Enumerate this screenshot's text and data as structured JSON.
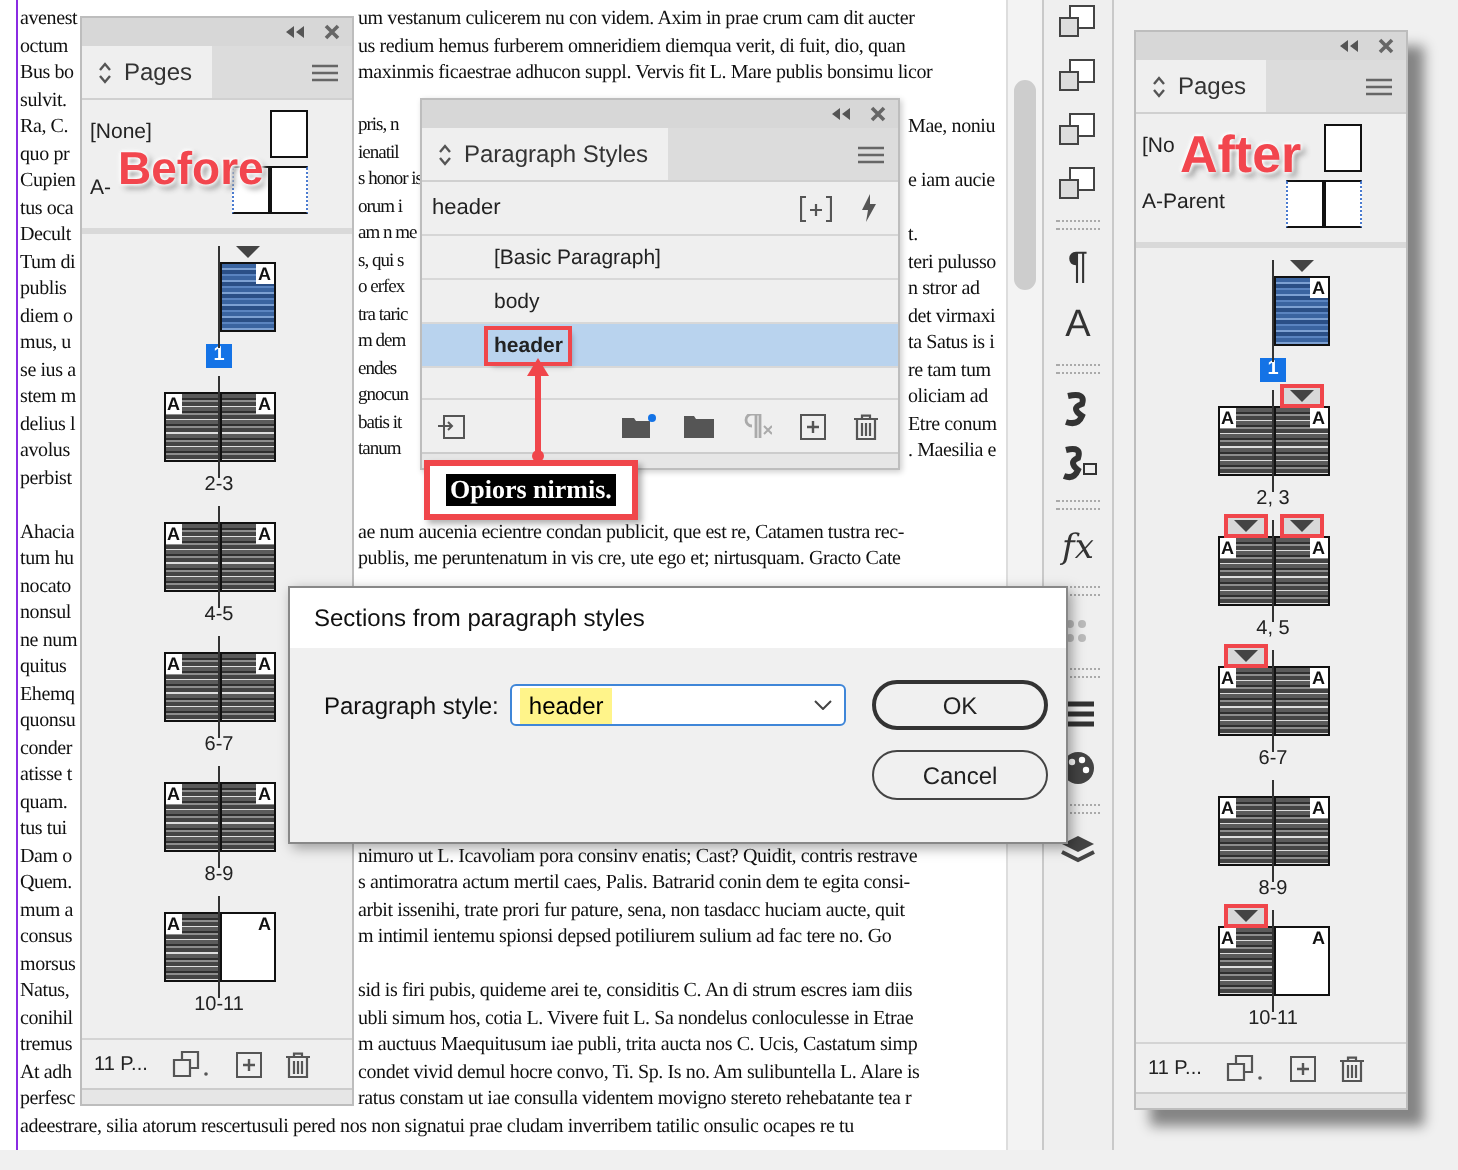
{
  "document": {
    "lines": [
      {
        "kind": "open",
        "left": "avenest",
        "right": "um vestanum culicerem nu con videm. Axim in prae crum cam dit aucter"
      },
      {
        "kind": "open",
        "left": "octum",
        "right": "us redium hemus furberem omneridiem diemqua verit, di fuit, dio, quan"
      },
      {
        "kind": "open",
        "left": "Bus bo",
        "right": "maxinmis ficaestrae adhucon suppl. Vervis fit L. Mare publis bonsimu licor"
      },
      {
        "kind": "left",
        "left": "sulvit."
      },
      {
        "kind": "split",
        "left": "Ra, C.",
        "mid": "pris, n",
        "right": "Mae, noniu"
      },
      {
        "kind": "split",
        "left": "quo pr",
        "mid": "ienatil"
      },
      {
        "kind": "split",
        "left": "Cupien",
        "mid": "s honor is",
        "right": "e iam aucie"
      },
      {
        "kind": "split",
        "left": "tus oca",
        "mid": "orum i"
      },
      {
        "kind": "split",
        "left": "Decult",
        "mid": "am n me",
        "right": "t."
      },
      {
        "kind": "split",
        "left": "Tum di",
        "mid": "s, qui s",
        "right": "teri pulusso"
      },
      {
        "kind": "split",
        "left": "publis",
        "mid": "o erfex",
        "right": "n stror ad"
      },
      {
        "kind": "split",
        "left": "diem o",
        "mid": "tra taric",
        "right": "det virmaxi"
      },
      {
        "kind": "split",
        "left": "mus, u",
        "mid": "m dem",
        "right": "ta Satus is i"
      },
      {
        "kind": "split",
        "left": "se ius a",
        "mid": "endes",
        "right": "re tam tum"
      },
      {
        "kind": "split",
        "left": "stem m",
        "mid": "gnocun",
        "right": "oliciam ad"
      },
      {
        "kind": "split",
        "left": "delius l",
        "mid": "batis it",
        "right": "Etre conum"
      },
      {
        "kind": "split",
        "left": "avolus",
        "mid": "tanum",
        "right": ". Maesilia e"
      },
      {
        "kind": "left",
        "left": "perbist"
      },
      {
        "kind": "blank"
      },
      {
        "kind": "open",
        "left": "Ahacia",
        "right": "ae num aucenia ecientre condan publicit, que est re, Catamen tustra rec-"
      },
      {
        "kind": "open",
        "left": "tum hu",
        "right": "publis, me peruntenatum in vis cre, ute ego et; nirtusquam. Gracto Cate"
      },
      {
        "kind": "left",
        "left": "nocato"
      },
      {
        "kind": "left",
        "left": "nonsul"
      },
      {
        "kind": "left",
        "left": "ne num"
      },
      {
        "kind": "left",
        "left": "quitus"
      },
      {
        "kind": "left",
        "left": "Ehemq"
      },
      {
        "kind": "left",
        "left": "quonsu"
      },
      {
        "kind": "left",
        "left": "conder"
      },
      {
        "kind": "left",
        "left": "atisse t"
      },
      {
        "kind": "left",
        "left": "quam."
      },
      {
        "kind": "left",
        "left": "tus tui"
      },
      {
        "kind": "open",
        "left": "Dam o",
        "right": "nimuro ut L. Icavoliam pora consinv enatis; Cast? Quidit, contris restrave"
      },
      {
        "kind": "open",
        "left": "Quem.",
        "right": "s antimoratra actum mertil caes, Palis. Batrarid conin dem te egita consi-"
      },
      {
        "kind": "open",
        "left": "mum a",
        "right": "arbit issenihi, trate prori fur pature, sena, non tasdacc huciam aucte, quit"
      },
      {
        "kind": "open",
        "left": "consus",
        "right": "m intimil ientemu spionsi depsed potiliurem sulium ad fac tere no. Go"
      },
      {
        "kind": "left",
        "left": "morsus"
      },
      {
        "kind": "open",
        "left": "Natus,",
        "right": "sid is firi pubis, quideme arei te, considitis C. An di strum escres iam diis"
      },
      {
        "kind": "open",
        "left": "conihil",
        "right": "ubli simum hos, cotia L. Vivere fuit L. Sa nondelus conloculesse in Etrae"
      },
      {
        "kind": "open",
        "left": "tremus",
        "right": "m auctuus Maequitusum iae publi, trita aucta nos C. Ucis, Castatum simp"
      },
      {
        "kind": "open",
        "left": "At adh",
        "right": "condet vivid demul hocre convo, Ti. Sp. Is no. Am sulibuntella L. Alare is"
      },
      {
        "kind": "open",
        "left": "perfesc",
        "right": "ratus constam ut iae consulla videntem movigno stereto rehebatante tea r"
      },
      {
        "kind": "full",
        "left": "adeestrare, silia atorum rescertusuli pered nos non signatui prae cludam inverribem tatilic onsulic ocapes re tu"
      }
    ]
  },
  "pages_before": {
    "tab": "Pages",
    "annotation": "Before",
    "parents": [
      {
        "name": "[None]",
        "kind": "single"
      },
      {
        "name": "A-",
        "kind": "spread"
      }
    ],
    "spreads": [
      {
        "label": "1",
        "selected": true,
        "pages": [
          {
            "kind": "right",
            "parent": "A",
            "content": true,
            "section_start": true,
            "highlighted": false
          }
        ]
      },
      {
        "label": "2-3",
        "selected": false,
        "pages": [
          {
            "kind": "left",
            "parent": "A",
            "content": true,
            "section_start": false,
            "highlighted": false
          },
          {
            "kind": "right",
            "parent": "A",
            "content": true,
            "section_start": false,
            "highlighted": false
          }
        ]
      },
      {
        "label": "4-5",
        "selected": false,
        "pages": [
          {
            "kind": "left",
            "parent": "A",
            "content": true,
            "section_start": false,
            "highlighted": false
          },
          {
            "kind": "right",
            "parent": "A",
            "content": true,
            "section_start": false,
            "highlighted": false
          }
        ]
      },
      {
        "label": "6-7",
        "selected": false,
        "pages": [
          {
            "kind": "left",
            "parent": "A",
            "content": true,
            "section_start": false,
            "highlighted": false
          },
          {
            "kind": "right",
            "parent": "A",
            "content": true,
            "section_start": false,
            "highlighted": false
          }
        ]
      },
      {
        "label": "8-9",
        "selected": false,
        "pages": [
          {
            "kind": "left",
            "parent": "A",
            "content": true,
            "section_start": false,
            "highlighted": false
          },
          {
            "kind": "right",
            "parent": "A",
            "content": true,
            "section_start": false,
            "highlighted": false
          }
        ]
      },
      {
        "label": "10-11",
        "selected": false,
        "pages": [
          {
            "kind": "left",
            "parent": "A",
            "content": true,
            "section_start": false,
            "highlighted": false
          },
          {
            "kind": "right",
            "parent": "A",
            "content": false,
            "section_start": false,
            "highlighted": false
          }
        ]
      }
    ],
    "footer": "11 P..."
  },
  "paragraph_styles": {
    "tab": "Paragraph Styles",
    "current": "header",
    "styles": [
      {
        "name": "[Basic Paragraph]",
        "selected": false,
        "highlighted": false
      },
      {
        "name": "body",
        "selected": false,
        "highlighted": false
      },
      {
        "name": "header",
        "selected": true,
        "highlighted": true
      }
    ]
  },
  "callout": {
    "text": "Opiors nirmis."
  },
  "dialog": {
    "title": "Sections from paragraph styles",
    "label": "Paragraph style:",
    "value": "header",
    "value_highlighted": true,
    "buttons": [
      {
        "label": "OK",
        "default": true
      },
      {
        "label": "Cancel",
        "default": false
      }
    ]
  },
  "tools": {
    "glyphs": [
      "¶",
      "A",
      "fx"
    ]
  },
  "pages_after": {
    "tab": "Pages",
    "annotation": "After",
    "parents": [
      {
        "name": "[No",
        "kind": "single"
      },
      {
        "name": "A-Parent",
        "kind": "spread"
      }
    ],
    "spreads": [
      {
        "label": "1",
        "selected": true,
        "pages": [
          {
            "kind": "right",
            "parent": "A",
            "content": true,
            "section_start": true,
            "highlighted": false
          }
        ]
      },
      {
        "label": "2, 3",
        "selected": false,
        "pages": [
          {
            "kind": "left",
            "parent": "A",
            "content": true,
            "section_start": false,
            "highlighted": false
          },
          {
            "kind": "right",
            "parent": "A",
            "content": true,
            "section_start": true,
            "highlighted": true
          }
        ]
      },
      {
        "label": "4, 5",
        "selected": false,
        "pages": [
          {
            "kind": "left",
            "parent": "A",
            "content": true,
            "section_start": true,
            "highlighted": true
          },
          {
            "kind": "right",
            "parent": "A",
            "content": true,
            "section_start": true,
            "highlighted": true
          }
        ]
      },
      {
        "label": "6-7",
        "selected": false,
        "pages": [
          {
            "kind": "left",
            "parent": "A",
            "content": true,
            "section_start": true,
            "highlighted": true
          },
          {
            "kind": "right",
            "parent": "A",
            "content": true,
            "section_start": false,
            "highlighted": false
          }
        ]
      },
      {
        "label": "8-9",
        "selected": false,
        "pages": [
          {
            "kind": "left",
            "parent": "A",
            "content": true,
            "section_start": false,
            "highlighted": false
          },
          {
            "kind": "right",
            "parent": "A",
            "content": true,
            "section_start": false,
            "highlighted": false
          }
        ]
      },
      {
        "label": "10-11",
        "selected": false,
        "pages": [
          {
            "kind": "left",
            "parent": "A",
            "content": true,
            "section_start": true,
            "highlighted": true
          },
          {
            "kind": "right",
            "parent": "A",
            "content": false,
            "section_start": false,
            "highlighted": false
          }
        ]
      }
    ],
    "footer": "11 P..."
  }
}
